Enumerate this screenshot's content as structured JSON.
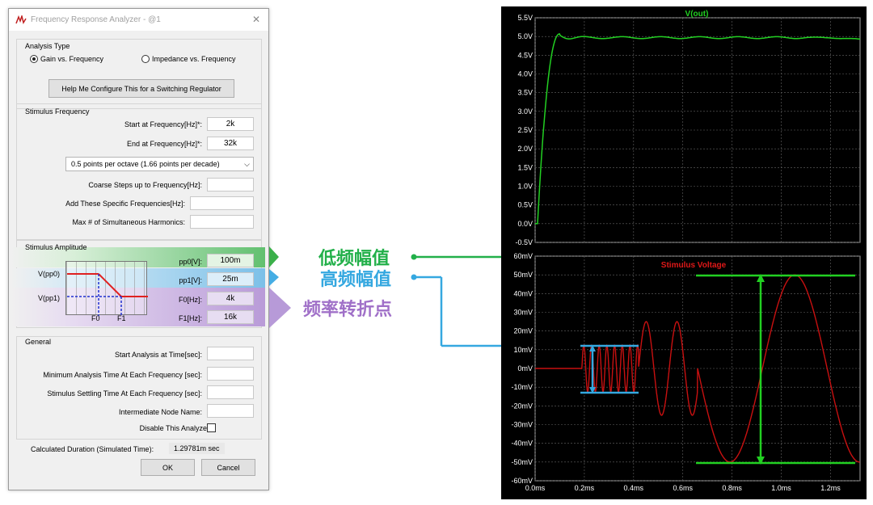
{
  "dialog": {
    "title": "Frequency Response Analyzer - @1",
    "analysis_type": {
      "label": "Analysis Type",
      "gain_label": "Gain vs. Frequency",
      "impedance_label": "Impedance vs. Frequency",
      "selected": "gain"
    },
    "help_button": "Help Me Configure This for a Switching Regulator",
    "stimulus_frequency": {
      "label": "Stimulus Frequency",
      "start_label": "Start at Frequency[Hz]*:",
      "start_value": "2k",
      "end_label": "End at Frequency[Hz]*:",
      "end_value": "32k",
      "points_option": "0.5 points per octave (1.66 points per decade)",
      "coarse_label": "Coarse Steps up to Frequency[Hz]:",
      "coarse_value": "",
      "specific_label": "Add These Specific Frequencies[Hz]:",
      "specific_value": "",
      "harmonics_label": "Max # of Simultaneous Harmonics:",
      "harmonics_value": ""
    },
    "stimulus_amplitude": {
      "label": "Stimulus Amplitude",
      "pp0_label": "pp0[V]:",
      "pp0_value": "100m",
      "pp1_label": "pp1[V]:",
      "pp1_value": "25m",
      "f0_label": "F0[Hz]:",
      "f0_value": "4k",
      "f1_label": "F1[Hz]:",
      "f1_value": "16k",
      "diagram_vpp0": "V(pp0)",
      "diagram_vpp1": "V(pp1)",
      "diagram_f0": "F0",
      "diagram_f1": "F1"
    },
    "general": {
      "label": "General",
      "start_time_label": "Start Analysis at Time[sec]:",
      "start_time_value": "",
      "min_time_label": "Minimum Analysis Time At Each Frequency [sec]:",
      "min_time_value": "",
      "settling_label": "Stimulus Settling Time At Each Frequency [sec]:",
      "settling_value": "",
      "node_label": "Intermediate Node Name:",
      "node_value": "",
      "disable_label": "Disable This Analyzer",
      "disable_checked": false
    },
    "duration_label": "Calculated Duration (Simulated Time):",
    "duration_value": "1.29781m sec",
    "ok_label": "OK",
    "cancel_label": "Cancel"
  },
  "annotations": {
    "low_freq_amplitude": "低频幅值",
    "high_freq_amplitude": "高频幅值",
    "corner_frequency": "频率转折点",
    "colors": {
      "green": "#22b04a",
      "blue": "#35a8e0",
      "purple": "#a070c8"
    }
  },
  "scope": {
    "top_panel": {
      "title": "V(out)",
      "y_ticks": [
        "5.5V",
        "5.0V",
        "4.5V",
        "4.0V",
        "3.5V",
        "3.0V",
        "2.5V",
        "2.0V",
        "1.5V",
        "1.0V",
        "0.5V",
        "0.0V",
        "-0.5V"
      ]
    },
    "bottom_panel": {
      "title": "Stimulus Voltage",
      "y_ticks": [
        "60mV",
        "50mV",
        "40mV",
        "30mV",
        "20mV",
        "10mV",
        "0mV",
        "-10mV",
        "-20mV",
        "-30mV",
        "-40mV",
        "-50mV",
        "-60mV"
      ]
    },
    "x_ticks": [
      "0.0ms",
      "0.2ms",
      "0.4ms",
      "0.6ms",
      "0.8ms",
      "1.0ms",
      "1.2ms"
    ],
    "colors": {
      "trace_top": "#22d022",
      "trace_bottom": "#c81010",
      "background": "#000000",
      "grid": "#666666"
    }
  }
}
